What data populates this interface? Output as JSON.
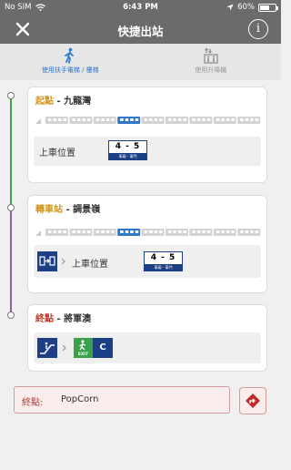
{
  "status_bar": {
    "carrier": "No SIM",
    "time": "6:43 PM",
    "battery_text": "60%",
    "battery_level": 0.6
  },
  "nav": {
    "title": "快捷出站",
    "close_icon": "close-icon",
    "info_icon": "info-icon",
    "info_glyph": "i"
  },
  "tabs": [
    {
      "label": "使用扶手電梯 / 樓梯",
      "icon": "escalator-walk-icon",
      "active": true
    },
    {
      "label": "使用升降機",
      "icon": "lift-icon",
      "active": false
    }
  ],
  "start": {
    "role": "起點",
    "separator": " - ",
    "station": "九龍灣",
    "role_color": "#d4961a",
    "highlight_car": 4,
    "boarding_label": "上車位置",
    "door_code": "4 - 5",
    "door_sub": "車廂 - 車門"
  },
  "transfer": {
    "role": "轉車站",
    "separator": " - ",
    "station": "調景嶺",
    "role_color": "#d4961a",
    "highlight_car": 4,
    "boarding_label": "上車位置",
    "door_code": "4 - 5",
    "door_sub": "車廂 - 車門",
    "cross_platform_icon": "cross-platform-icon"
  },
  "end": {
    "role": "終點",
    "separator": " - ",
    "station": "將軍澳",
    "role_color": "#c0392b",
    "escalator_icon": "escalator-icon",
    "exit_label": "EXIT",
    "exit_code": "C"
  },
  "destination": {
    "label": "終點:",
    "value": "PopCorn",
    "icon": "directions-icon"
  },
  "colors": {
    "accent": "#2f77c8",
    "line_green": "#3aa04a",
    "line_purple": "#8e5fa8",
    "door_navy": "#1c3f85",
    "exit_green": "#3aa04a"
  }
}
